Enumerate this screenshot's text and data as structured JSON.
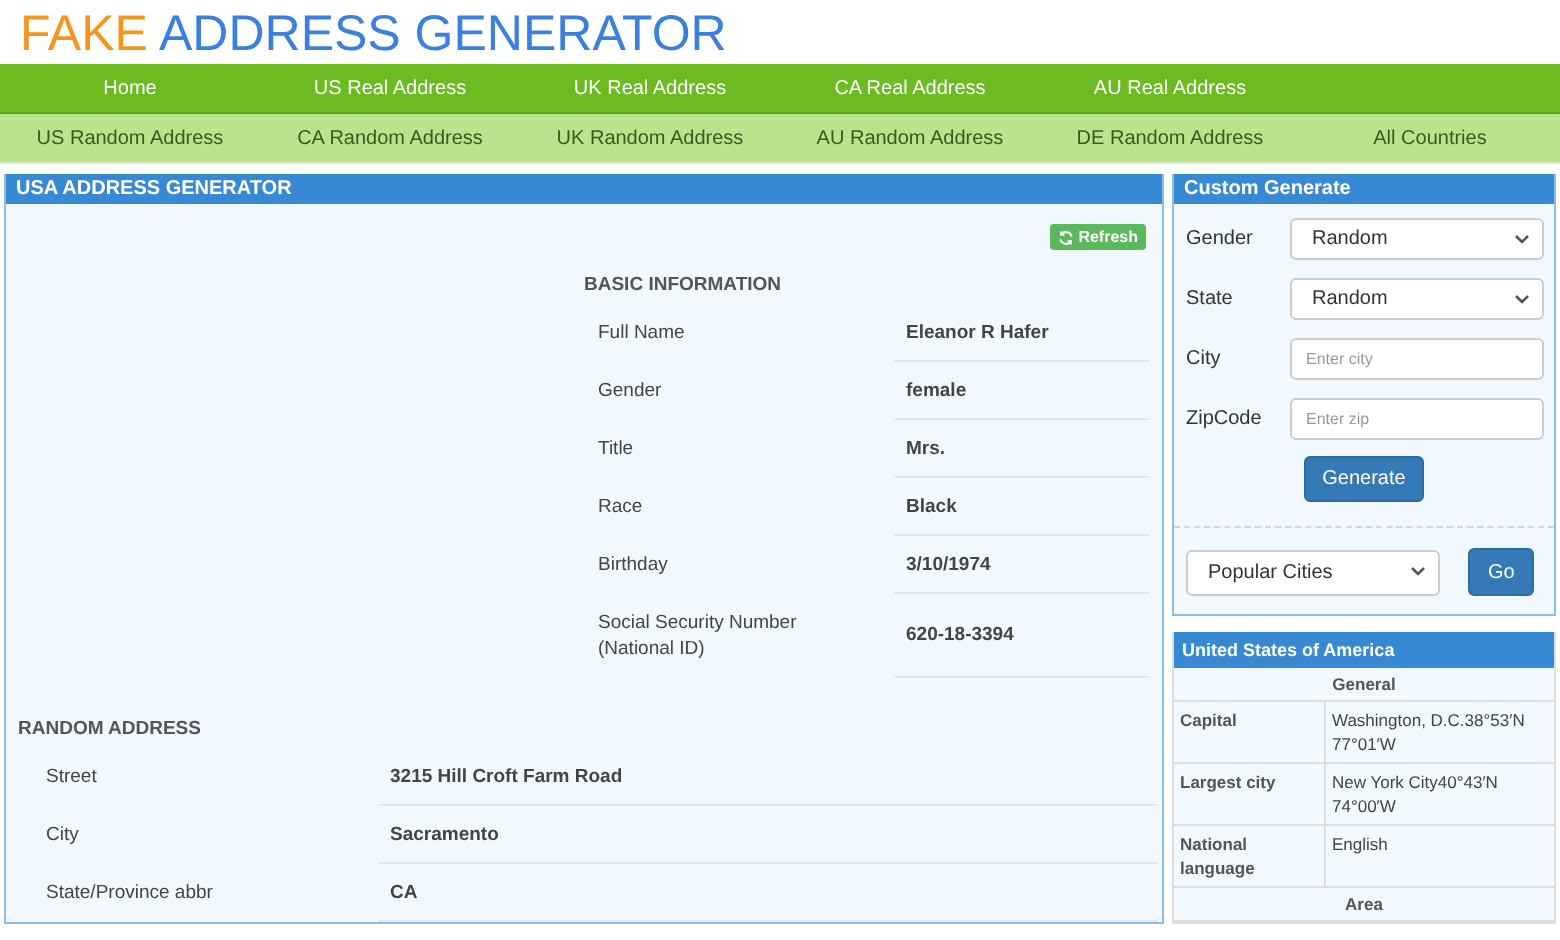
{
  "logo": {
    "first": "FAKE",
    "rest": "ADDRESS GENERATOR"
  },
  "main_nav": [
    "Home",
    "US Real Address",
    "UK Real Address",
    "CA Real Address",
    "AU Real Address"
  ],
  "sub_nav": [
    "US Random Address",
    "CA Random Address",
    "UK Random Address",
    "AU Random Address",
    "DE Random Address",
    "All Countries"
  ],
  "generator": {
    "title": "USA ADDRESS GENERATOR",
    "refresh": "Refresh",
    "basic": {
      "heading": "BASIC INFORMATION",
      "rows": [
        {
          "label": "Full Name",
          "value": "Eleanor R Hafer"
        },
        {
          "label": "Gender",
          "value": "female"
        },
        {
          "label": "Title",
          "value": "Mrs."
        },
        {
          "label": "Race",
          "value": "Black"
        },
        {
          "label": "Birthday",
          "value": "3/10/1974"
        },
        {
          "label": "Social Security Number (National ID)",
          "value": "620-18-3394"
        }
      ]
    },
    "address": {
      "heading": "RANDOM ADDRESS",
      "rows": [
        {
          "label": "Street",
          "value": "3215 Hill Croft Farm Road"
        },
        {
          "label": "City",
          "value": "Sacramento"
        },
        {
          "label": "State/Province abbr",
          "value": "CA"
        }
      ]
    }
  },
  "custom": {
    "title": "Custom Generate",
    "fields": [
      {
        "kind": "select",
        "label": "Gender",
        "value": "Random"
      },
      {
        "kind": "select",
        "label": "State",
        "value": "Random"
      },
      {
        "kind": "input",
        "label": "City",
        "placeholder": "Enter city"
      },
      {
        "kind": "input",
        "label": "ZipCode",
        "placeholder": "Enter zip"
      }
    ],
    "button": "Generate",
    "cities": "Popular Cities",
    "go": "Go"
  },
  "country": {
    "title": "United States of America",
    "rows": [
      {
        "kind": "section",
        "label": "General"
      },
      {
        "kind": "pair",
        "label": "Capital",
        "value": "Washington, D.C.38°53′N 77°01′W"
      },
      {
        "kind": "pair",
        "label": "Largest city",
        "value": "New York City40°43′N 74°00′W"
      },
      {
        "kind": "pair",
        "label": "National language",
        "value": "English"
      },
      {
        "kind": "section",
        "label": "Area"
      }
    ]
  }
}
